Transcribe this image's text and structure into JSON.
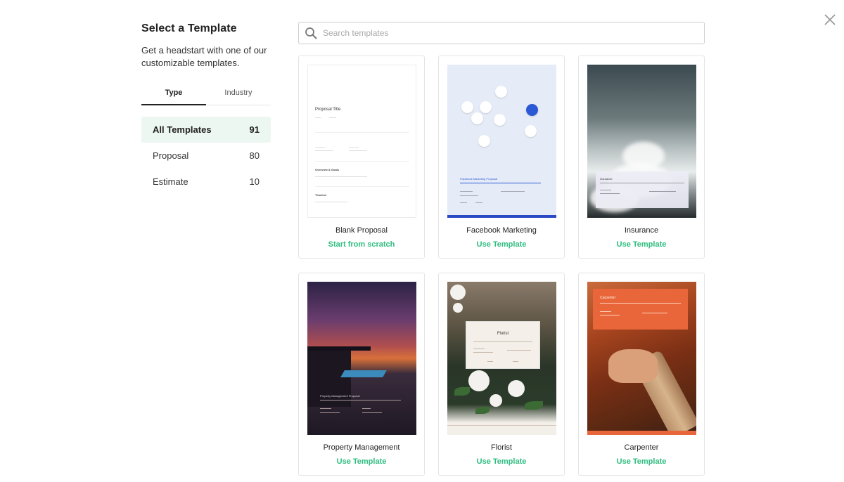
{
  "header": {
    "title": "Select a Template",
    "subtitle": "Get a headstart with one of our customizable templates."
  },
  "tabs": [
    {
      "label": "Type",
      "active": true
    },
    {
      "label": "Industry",
      "active": false
    }
  ],
  "categories": [
    {
      "label": "All Templates",
      "count": "91",
      "selected": true
    },
    {
      "label": "Proposal",
      "count": "80",
      "selected": false
    },
    {
      "label": "Estimate",
      "count": "10",
      "selected": false
    }
  ],
  "search": {
    "placeholder": "Search templates",
    "value": ""
  },
  "templates": [
    {
      "name": "Blank Proposal",
      "action": "Start from scratch",
      "preview": {
        "doc_title": "Proposal Title",
        "section_1": "Overview & Goals",
        "section_2": "Timeline"
      }
    },
    {
      "name": "Facebook Marketing",
      "action": "Use Template",
      "preview": {
        "doc_title": "Facebook Marketing Proposal"
      }
    },
    {
      "name": "Insurance",
      "action": "Use Template",
      "preview": {
        "doc_title": "Insurance"
      }
    },
    {
      "name": "Property Management",
      "action": "Use Template",
      "preview": {
        "doc_title": "Property Management Proposal"
      }
    },
    {
      "name": "Florist",
      "action": "Use Template",
      "preview": {
        "doc_title": "Florist"
      }
    },
    {
      "name": "Carpenter",
      "action": "Use Template",
      "preview": {
        "doc_title": "Carpenter"
      }
    }
  ],
  "colors": {
    "accent_green": "#2ebd7f",
    "selected_bg": "#edf7f2",
    "facebook_blue": "#2b58d4",
    "carpenter_orange": "#e8663a"
  },
  "icons": {
    "close": "close-icon",
    "search": "search-icon"
  }
}
